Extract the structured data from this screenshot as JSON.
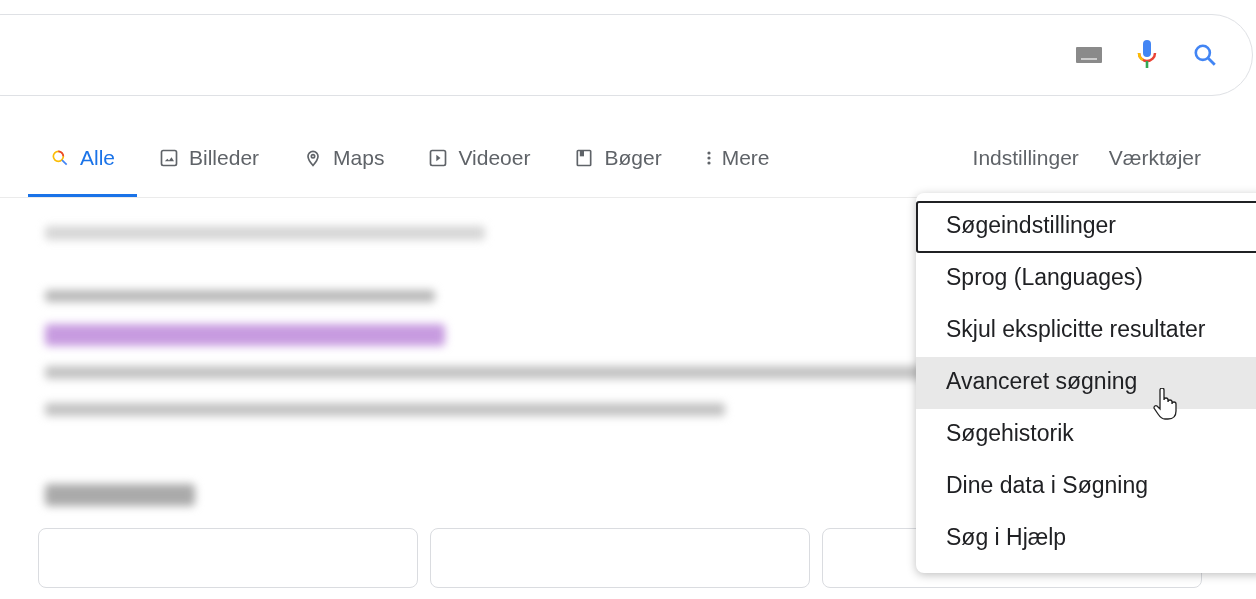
{
  "tabs": [
    {
      "kind": "all",
      "label": "Alle",
      "selected": true
    },
    {
      "kind": "images",
      "label": "Billeder",
      "selected": false
    },
    {
      "kind": "maps",
      "label": "Maps",
      "selected": false
    },
    {
      "kind": "videos",
      "label": "Videoer",
      "selected": false
    },
    {
      "kind": "books",
      "label": "Bøger",
      "selected": false
    },
    {
      "kind": "more",
      "label": "Mere",
      "selected": false
    }
  ],
  "tools": [
    "Indstillinger",
    "Værktøjer"
  ],
  "settings_menu": [
    {
      "label": "Søgeindstillinger",
      "focused": true,
      "highlighted": false
    },
    {
      "label": "Sprog  (Languages)",
      "focused": false,
      "highlighted": false
    },
    {
      "label": "Skjul eksplicitte resultater",
      "focused": false,
      "highlighted": false
    },
    {
      "label": "Avanceret søgning",
      "focused": false,
      "highlighted": true
    },
    {
      "label": "Søgehistorik",
      "focused": false,
      "highlighted": false
    },
    {
      "label": "Dine data i Søgning",
      "focused": false,
      "highlighted": false
    },
    {
      "label": "Søg i Hjælp",
      "focused": false,
      "highlighted": false
    }
  ]
}
